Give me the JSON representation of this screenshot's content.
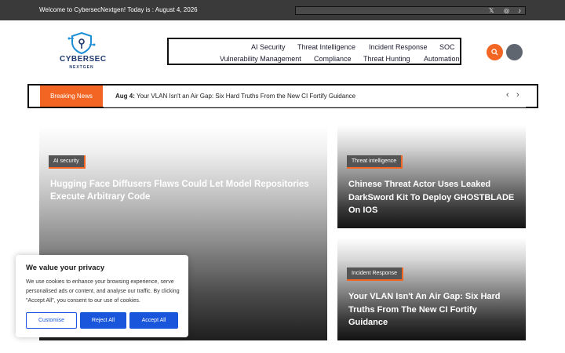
{
  "topbar": {
    "welcome": "Welcome to CybersecNextgen! Today is : August 4, 2026",
    "social_icons": [
      "x-icon",
      "instagram-icon",
      "tiktok-icon"
    ],
    "x_glyph": "𝕏",
    "instagram_glyph": "◎",
    "tiktok_glyph": "♪"
  },
  "logo": {
    "brand": "CYBERSEC",
    "sub": "NEXTGEN"
  },
  "nav": {
    "row1": [
      "AI Security",
      "Threat Intelligence",
      "Incident Response",
      "SOC"
    ],
    "row2": [
      "Vulnerability Management",
      "Compliance",
      "Threat Hunting",
      "Automation"
    ]
  },
  "breaking": {
    "label": "Breaking News",
    "date": "Aug 4:",
    "text": " Your VLAN Isn't an Air Gap: Six Hard Truths From the New CI Fortify Guidance",
    "prev": "‹",
    "next": "›"
  },
  "cards": [
    {
      "tag": "AI security",
      "headline": "Hugging Face Diffusers Flaws Could Let Model Repositories Execute Arbitrary Code"
    },
    {
      "tag": "Threat intelligence",
      "headline": "Chinese Threat Actor Uses Leaked DarkSword Kit To Deploy GHOSTBLADE On IOS"
    },
    {
      "tag": "Incident Response",
      "headline": "Your VLAN Isn't An Air Gap: Six Hard Truths From The New CI Fortify Guidance"
    }
  ],
  "cookie": {
    "title": "We value your privacy",
    "body": "We use cookies to enhance your browsing experience, serve personalised ads or content, and analyse our traffic. By clicking \"Accept All\", you consent to our use of cookies.",
    "customise": "Customise",
    "reject": "Reject All",
    "accept": "Accept All"
  },
  "colors": {
    "accent": "#f26522",
    "topbar": "#3a3a3a",
    "brand": "#1e3a6e",
    "cookie_button": "#1a56db"
  }
}
